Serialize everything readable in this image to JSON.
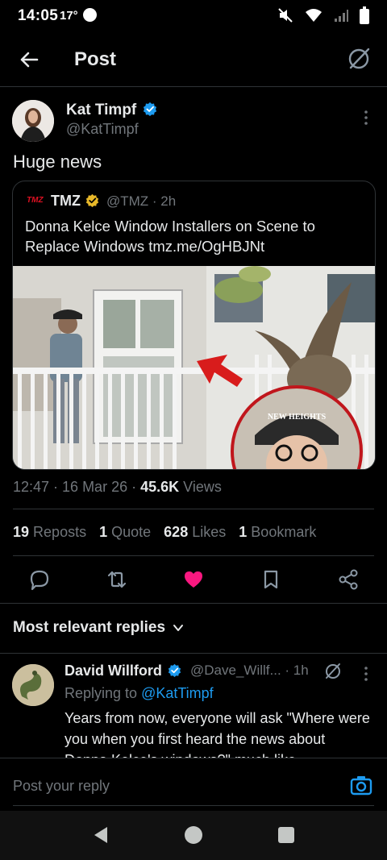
{
  "status": {
    "time": "14:05",
    "temp": "17°"
  },
  "header": {
    "title": "Post"
  },
  "author": {
    "name": "Kat Timpf",
    "handle": "@KatTimpf",
    "verified": true
  },
  "post": {
    "text": "Huge news",
    "timestamp": "12:47 · 16 Mar 26 · ",
    "views_count": "45.6K",
    "views_label": " Views"
  },
  "quote": {
    "logo": "TMZ",
    "name": "TMZ",
    "meta": "@TMZ · 2h",
    "text": "Donna Kelce Window Installers on Scene to Replace Windows tmz.me/OgHBJNt",
    "cap_text": "NEW HEIGHTS"
  },
  "stats": [
    {
      "count": "19",
      "label": "Reposts"
    },
    {
      "count": "1",
      "label": "Quote"
    },
    {
      "count": "628",
      "label": "Likes"
    },
    {
      "count": "1",
      "label": "Bookmark"
    }
  ],
  "actions": {
    "reply": "reply-icon",
    "repost": "repost-icon",
    "like": "heart-icon",
    "bookmark": "bookmark-icon",
    "share": "share-icon",
    "like_color": "#f91880"
  },
  "replies_filter": {
    "label": "Most relevant replies"
  },
  "reply": {
    "name": "David Willford",
    "meta": "@Dave_Willf... · 1h",
    "replying_prefix": "Replying to ",
    "replying_to": "@KatTimpf",
    "text": "Years from now, everyone will ask \"Where were you when you first heard the news about Donna Kelce's windows?\" much like"
  },
  "compose": {
    "placeholder": "Post your reply"
  },
  "colors": {
    "accent": "#1d9bf0",
    "gold": "#e8b829",
    "background": "#000000"
  }
}
